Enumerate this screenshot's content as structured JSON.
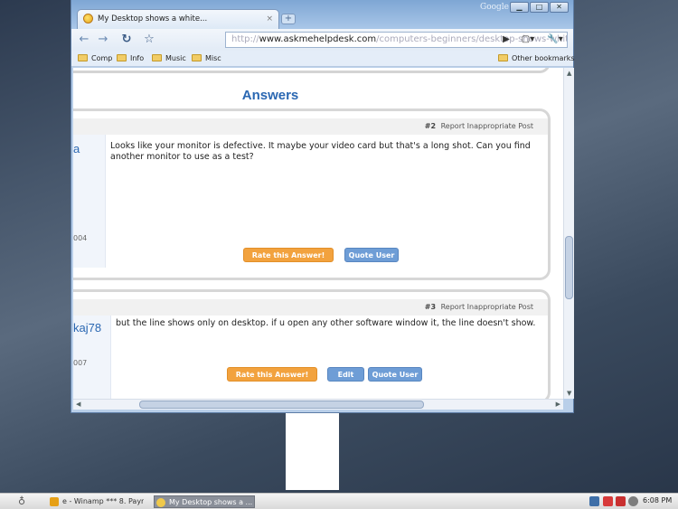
{
  "browser": {
    "tab_title": "My Desktop shows a white...",
    "tab_close": "×",
    "new_tab": "+",
    "google_label": "Google",
    "window_buttons": {
      "minimize": "▁",
      "maximize": "□",
      "close": "✕"
    },
    "nav": {
      "back": "←",
      "forward": "→",
      "reload": "↻",
      "star": "☆",
      "go": "▶",
      "page_menu": "▢▾",
      "tools_menu": "🔧▾"
    },
    "url": {
      "scheme": "http://",
      "domain": "www.askmehelpdesk.com",
      "path": "/computers-beginners/desktop-shows-white-strip-"
    },
    "bookmarks": [
      "Comp",
      "Info",
      "Music",
      "Misc"
    ],
    "other_bookmarks": "Other bookmarks"
  },
  "page": {
    "section_title": "Answers",
    "posts": [
      {
        "number": "#2",
        "report": "Report Inappropriate Post",
        "username": "a",
        "year": "004",
        "text": "Looks like your monitor is defective. It maybe your video card but that's a long shot. Can you find another monitor to use as a test?",
        "buttons": {
          "rate": "Rate this Answer!",
          "quote": "Quote User"
        }
      },
      {
        "number": "#3",
        "report": "Report Inappropriate Post",
        "username": "kaj78",
        "year": "007",
        "text": "but the line shows only on desktop. if u open any other software window it, the line doesn't show.",
        "buttons": {
          "rate": "Rate this Answer!",
          "edit": "Edit",
          "quote": "Quote User"
        }
      }
    ]
  },
  "taskbar": {
    "tasks": [
      {
        "label": "e - Winamp *** 8. Payr ..."
      },
      {
        "label": "My Desktop shows a ..."
      }
    ],
    "clock": "6:08 PM"
  },
  "colors": {
    "accent": "#2a67b2",
    "button_orange": "#f2a23e",
    "button_blue": "#6e9dd6"
  }
}
